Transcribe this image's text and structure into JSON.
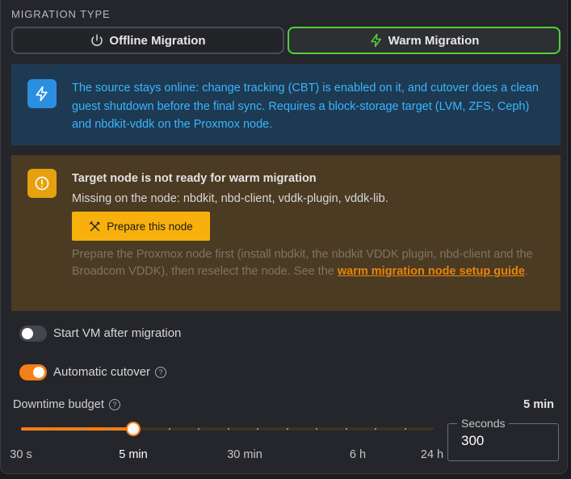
{
  "migration_type": {
    "label": "MIGRATION TYPE",
    "options": [
      {
        "label": "Offline Migration",
        "icon": "power-icon",
        "selected": false
      },
      {
        "label": "Warm Migration",
        "icon": "bolt-icon",
        "selected": true
      }
    ]
  },
  "info": {
    "text": "The source stays online: change tracking (CBT) is enabled on it, and cutover does a clean guest shutdown before the final sync. Requires a block-storage target (LVM, ZFS, Ceph) and nbdkit-vddk on the Proxmox node.",
    "icon": "bolt-icon",
    "color": "#3ab4ff"
  },
  "warning": {
    "title": "Target node is not ready for warm migration",
    "missing": "Missing on the node: nbdkit, nbd-client, vddk-plugin, vddk-lib.",
    "prepare_button": "Prepare this node",
    "help_prefix": "Prepare the Proxmox node first (install nbdkit, the nbdkit VDDK plugin, nbd-client and the Broadcom VDDK), then reselect the node. See the ",
    "help_link": "warm migration node setup guide",
    "help_suffix": ".",
    "icon": "alert-circle-icon",
    "color": "#f8b10c"
  },
  "options": {
    "start_vm": {
      "label": "Start VM after migration",
      "checked": false
    },
    "auto_cutover": {
      "label": "Automatic cutover",
      "checked": true
    }
  },
  "downtime": {
    "label": "Downtime budget",
    "value_label": "5 min",
    "slider_fraction": 0.272,
    "marks": [
      {
        "label": "30 s",
        "pos": 0.0
      },
      {
        "label": "5 min",
        "pos": 0.272
      },
      {
        "label": "30 min",
        "pos": 0.5
      },
      {
        "label": "6 h",
        "pos": 0.75
      },
      {
        "label": "24 h",
        "pos": 1.0
      }
    ],
    "seconds_label": "Seconds",
    "seconds_value": "300"
  },
  "colors": {
    "accent": "#f47f16",
    "selected_border": "#52d03c"
  }
}
